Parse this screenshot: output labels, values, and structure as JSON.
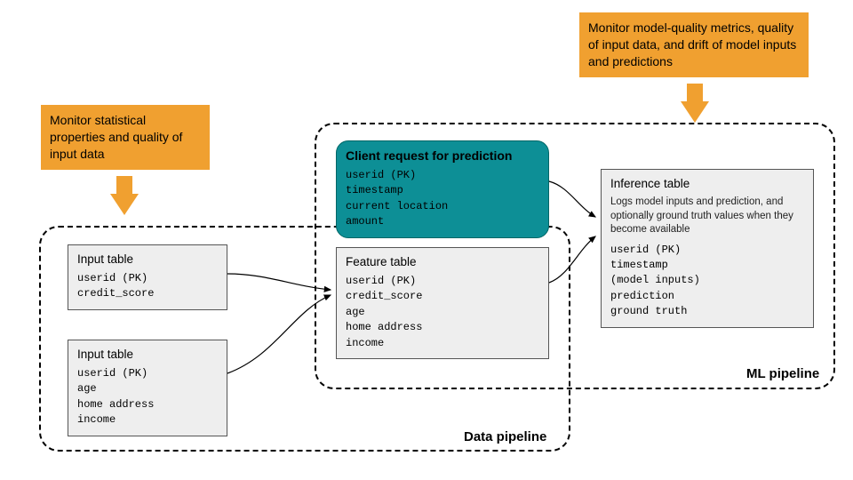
{
  "callouts": {
    "left": "Monitor statistical properties and quality of input data",
    "right": "Monitor model-quality metrics, quality of input data, and drift of model inputs and predictions"
  },
  "pipelines": {
    "data_label": "Data pipeline",
    "ml_label": "ML pipeline"
  },
  "input_table_1": {
    "title": "Input table",
    "fields": "userid (PK)\ncredit_score"
  },
  "input_table_2": {
    "title": "Input table",
    "fields": "userid (PK)\nage\nhome address\nincome"
  },
  "feature_table": {
    "title": "Feature table",
    "fields": "userid (PK)\ncredit_score\nage\nhome address\nincome"
  },
  "request": {
    "title": "Client request for prediction",
    "fields": "userid (PK)\ntimestamp\ncurrent location\namount"
  },
  "inference": {
    "title": "Inference table",
    "subtitle": "Logs model inputs and prediction, and optionally ground truth values when they become available",
    "fields": "userid (PK)\ntimestamp\n(model inputs)\nprediction\nground truth"
  }
}
